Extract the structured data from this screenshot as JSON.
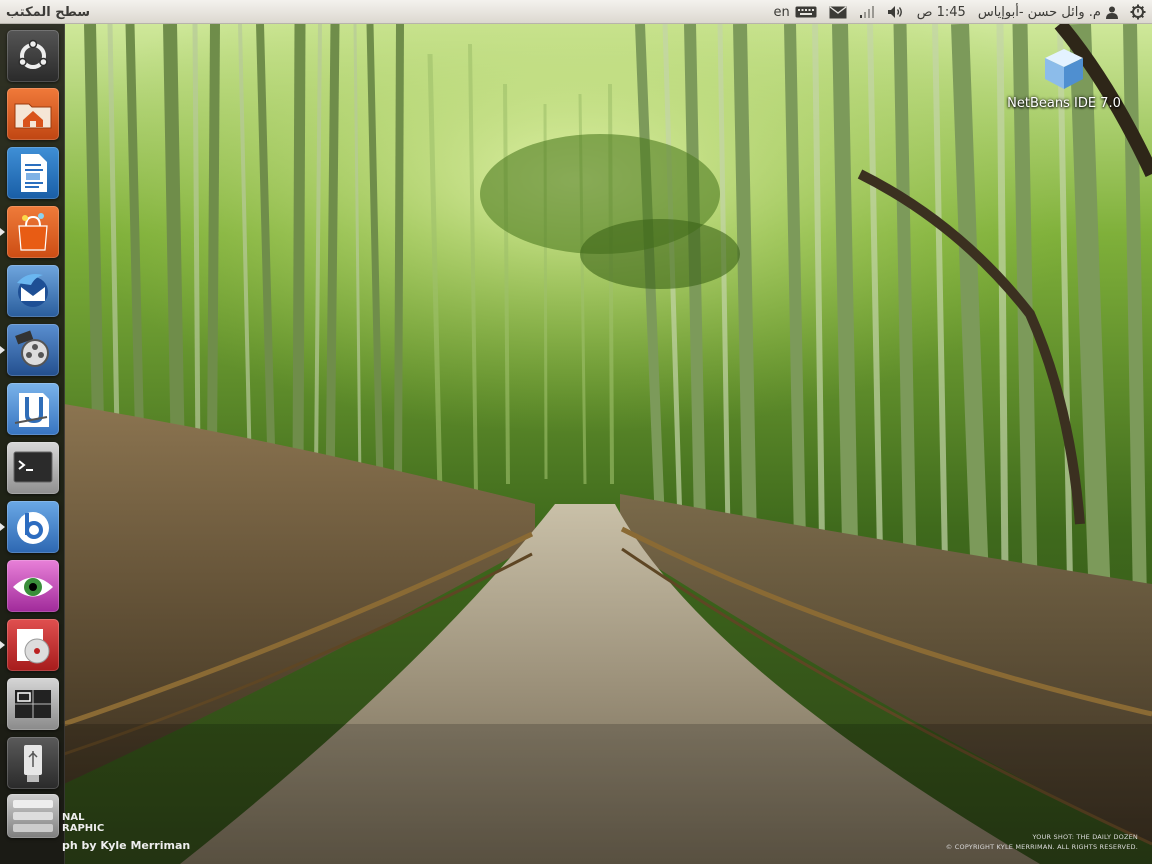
{
  "top_panel": {
    "app_title": "سطح المكتب",
    "keyboard_layout": "en",
    "clock": "1:45 ص",
    "user_name": "م. وائل حسن -أبوإياس"
  },
  "desktop": {
    "icons": [
      {
        "label": "NetBeans IDE 7.0",
        "icon": "netbeans-cube-icon"
      }
    ]
  },
  "launcher": {
    "items": [
      {
        "name": "ubuntu-home",
        "icon": "ubuntu-logo-icon"
      },
      {
        "name": "home-folder",
        "icon": "home-folder-icon"
      },
      {
        "name": "libreoffice-writer",
        "icon": "document-writer-icon"
      },
      {
        "name": "ubuntu-software-center",
        "icon": "shopping-bag-icon"
      },
      {
        "name": "thunderbird",
        "icon": "thunderbird-icon"
      },
      {
        "name": "openshot-video-editor",
        "icon": "video-editor-icon"
      },
      {
        "name": "kompozer",
        "icon": "web-editor-icon"
      },
      {
        "name": "terminal",
        "icon": "terminal-icon"
      },
      {
        "name": "bluefish",
        "icon": "bluefish-icon"
      },
      {
        "name": "xsane-scanner",
        "icon": "eye-icon"
      },
      {
        "name": "disc-burner",
        "icon": "disc-burner-icon"
      },
      {
        "name": "workspace-switcher",
        "icon": "workspace-switcher-icon"
      },
      {
        "name": "usb-drive",
        "icon": "usb-drive-icon"
      },
      {
        "name": "trash",
        "icon": "trash-icon"
      }
    ]
  },
  "wallpaper_credits": {
    "brand_line1": "NAL",
    "brand_line2": "RAPHIC",
    "photographer": "ph by Kyle Merriman",
    "series": "YOUR SHOT: THE DAILY DOZEN",
    "copyright": "© COPYRIGHT KYLE MERRIMAN. ALL RIGHTS RESERVED."
  },
  "colors": {
    "panel_bg": "#e8e6e1",
    "launcher_bg": "#1a1816",
    "accent_orange": "#e05a1e"
  }
}
